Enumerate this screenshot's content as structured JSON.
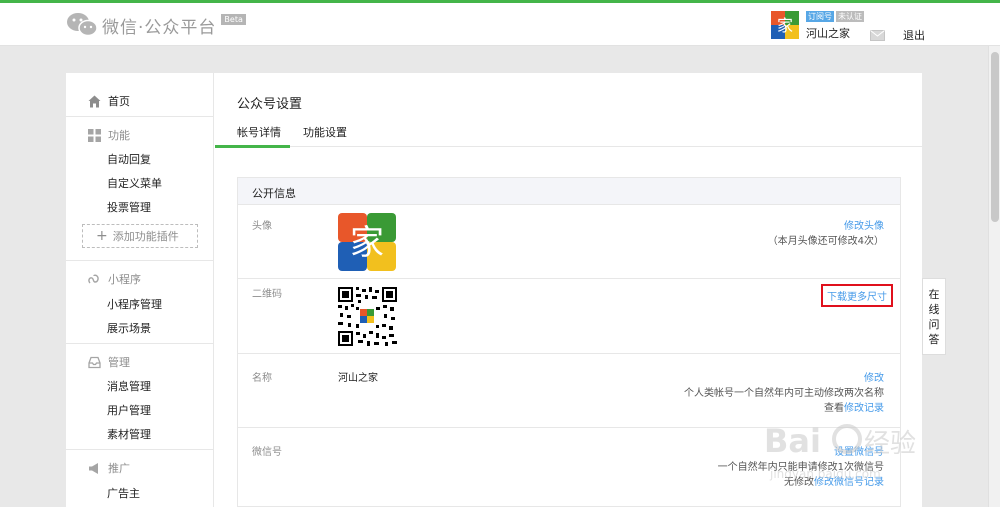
{
  "header": {
    "logo_text": "微信·公众平台",
    "beta": "Beta",
    "account": {
      "tag_subscription": "订阅号",
      "tag_unverified": "未认证",
      "name": "河山之家"
    },
    "logout": "退出"
  },
  "sidebar": {
    "home": "首页",
    "function_group": "功能",
    "function_items": [
      "自动回复",
      "自定义菜单",
      "投票管理"
    ],
    "add_plugin": "添加功能插件",
    "miniprogram_group": "小程序",
    "miniprogram_items": [
      "小程序管理",
      "展示场景"
    ],
    "manage_group": "管理",
    "manage_items": [
      "消息管理",
      "用户管理",
      "素材管理"
    ],
    "promote_group": "推广",
    "promote_items": [
      "广告主"
    ]
  },
  "content": {
    "page_title": "公众号设置",
    "tabs": [
      "帐号详情",
      "功能设置"
    ],
    "panel_title": "公开信息",
    "avatar_row": {
      "label": "头像",
      "action": "修改头像",
      "note": "（本月头像还可修改4次）"
    },
    "qrcode_row": {
      "label": "二维码",
      "action": "下载更多尺寸"
    },
    "name_row": {
      "label": "名称",
      "value": "河山之家",
      "action": "修改",
      "note": "个人类帐号一个自然年内可主动修改两次名称",
      "history_prefix": "查看",
      "history_link": "修改记录"
    },
    "wechat_row": {
      "label": "微信号",
      "action": "设置微信号",
      "note": "一个自然年内只能申请修改1次微信号",
      "history_prefix": "无修改",
      "history_link": "修改微信号记录"
    }
  },
  "online_help": [
    "在",
    "线",
    "问",
    "答"
  ],
  "colors": {
    "brand_green": "#44b549",
    "link_blue": "#459ae9",
    "highlight_red": "#e0101c"
  }
}
